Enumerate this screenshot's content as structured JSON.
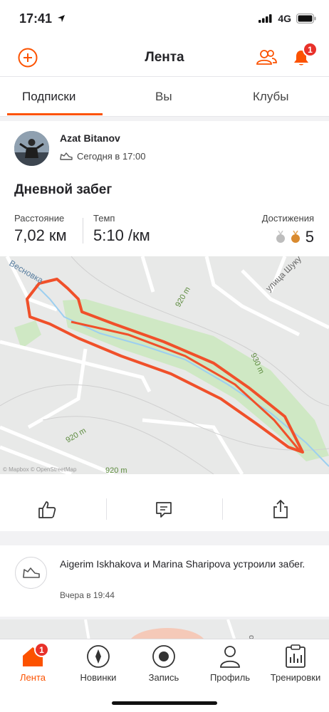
{
  "status_bar": {
    "time": "17:41",
    "network": "4G"
  },
  "header": {
    "title": "Лента",
    "notification_count": "1"
  },
  "tabs": [
    {
      "label": "Подписки",
      "active": true
    },
    {
      "label": "Вы",
      "active": false
    },
    {
      "label": "Клубы",
      "active": false
    }
  ],
  "activity": {
    "author": "Azat Bitanov",
    "time": "Сегодня в 17:00",
    "title": "Дневной забег",
    "stats": {
      "distance_label": "Расстояние",
      "distance_value": "7,02 км",
      "pace_label": "Темп",
      "pace_value": "5:10 /км",
      "achievements_label": "Достижения",
      "achievements_value": "5"
    },
    "map": {
      "street_1": "Весновка",
      "street_2": "улица Шуку",
      "contour_1": "920 m",
      "contour_2": "930 m",
      "contour_3": "920 m",
      "contour_4": "920 m",
      "attribution": "© Mapbox © OpenStreetMap"
    }
  },
  "group_activity": {
    "text": "Aigerim Iskhakova и Marina Sharipova устроили забег.",
    "time": "Вчера в 19:44"
  },
  "peek": {
    "street": "офа"
  },
  "tabbar": [
    {
      "label": "Лента",
      "active": true,
      "badge": "1"
    },
    {
      "label": "Новинки",
      "active": false
    },
    {
      "label": "Запись",
      "active": false
    },
    {
      "label": "Профиль",
      "active": false
    },
    {
      "label": "Тренировки",
      "active": false
    }
  ],
  "colors": {
    "accent": "#fc5200",
    "badge": "#e8312a",
    "route": "#f0502a",
    "park": "#cfe8c4"
  }
}
